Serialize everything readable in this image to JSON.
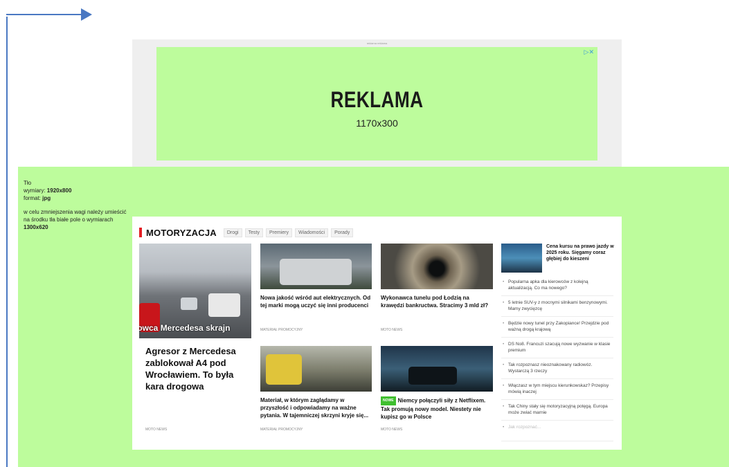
{
  "ad": {
    "top_note": "reklama reklama",
    "title": "REKLAMA",
    "size": "1170x300",
    "choices_icon": "adchoices-icon"
  },
  "background_info": {
    "label": "Tło",
    "dims_label": "wymiary:",
    "dims_value": "1920x800",
    "format_label": "format:",
    "format_value": "jpg",
    "note": "w celu zmniejszenia wagi należy umieścić na środku tła białe pole o wymiarach",
    "note_value": "1300x620"
  },
  "section": {
    "title": "MOTORYZACJA",
    "tabs": [
      "Drogi",
      "Testy",
      "Premiery",
      "Wiadomości",
      "Porady"
    ]
  },
  "lead": {
    "caption": "erowca Mercedesa skrajn",
    "title": "Agresor z Mercedesa zablokował A4 pod Wrocławiem. To była kara drogowa",
    "source": "MOTO NEWS"
  },
  "cards": [
    {
      "title": "Nowa jakość wśród aut elektrycznych. Od tej marki mogą uczyć się inni producenci",
      "source": "MATERIAŁ PROMOCYJNY"
    },
    {
      "title": "Wykonawca tunelu pod Łodzią na krawędzi bankructwa. Stracimy 3 mld zł?",
      "source": "MOTO NEWS"
    },
    {
      "title": "Materiał, w którym zaglądamy w przyszłość i odpowiadamy na ważne pytania. W tajemniczej skrzyni kryje się...",
      "source": "MATERIAŁ PROMOCYJNY"
    },
    {
      "badge": "NOWE",
      "title": "Niemcy połączyli siły z Netflixem. Tak promują nowy model. Niestety nie kupisz go w Polsce",
      "source": "MOTO NEWS"
    }
  ],
  "sidebar": {
    "feature_title": "Cena kursu na prawo jazdy w 2025 roku. Sięgamy coraz głębiej do kieszeni",
    "items": [
      "Popularna apka dla kierowców z kolejną aktualizacją. Co ma nowego?",
      "5 letnie SUV-y z mocnymi silnikami benzynowymi. Mamy zwycięzcę",
      "Będzie nowy tunel przy Zakopiance! Przejdzie pod ważną drogą krajową",
      "DS No8. Francuzi szacują nowe wyzwanie w klasie premium",
      "Tak rozpoznasz nieoznakowany radiowóz. Wystarczą 3 rzeczy",
      "Włączasz w tym miejscu kierunkowskaz? Przepisy mówią inaczej",
      "Tak Chiny stały się motoryzacyjną potęgą. Europa może zwiać marnie",
      "Jak rozpoznać..."
    ]
  }
}
